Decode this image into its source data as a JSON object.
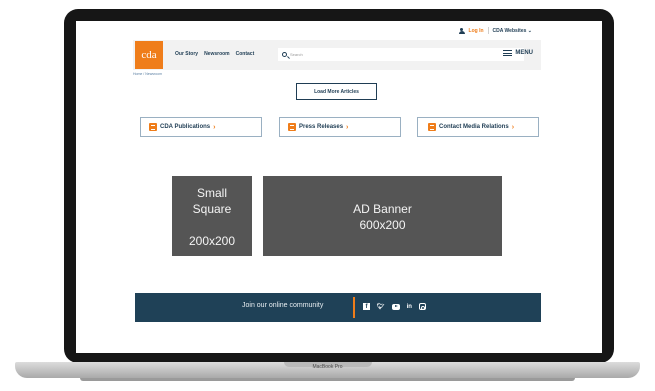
{
  "util": {
    "login_label": "Log In",
    "websites_label": "CDA Websites ⌄"
  },
  "header": {
    "logo_text": "cda",
    "nav": [
      "Our Story",
      "Newsroom",
      "Contact"
    ],
    "search_placeholder": "Search",
    "menu_label": "MENU"
  },
  "breadcrumb": "Home / Newsroom",
  "load_more_label": "Load More Articles",
  "links": [
    {
      "label": "CDA Publications",
      "chevron": "›"
    },
    {
      "label": "Press Releases",
      "chevron": "›"
    },
    {
      "label": "Contact Media Relations",
      "chevron": "›"
    }
  ],
  "ads": {
    "small_line1": "Small",
    "small_line2": "Square",
    "small_size": "200x200",
    "big_line1": "AD Banner",
    "big_line2": "600x200"
  },
  "footer": {
    "join_text": "Join our online community",
    "social": [
      "facebook-icon",
      "twitter-icon",
      "youtube-icon",
      "linkedin-icon",
      "instagram-icon"
    ]
  },
  "device_label": "MacBook Pro",
  "colors": {
    "brand_orange": "#ef7d1a",
    "brand_navy": "#1f4157",
    "ad_gray": "#555555"
  }
}
